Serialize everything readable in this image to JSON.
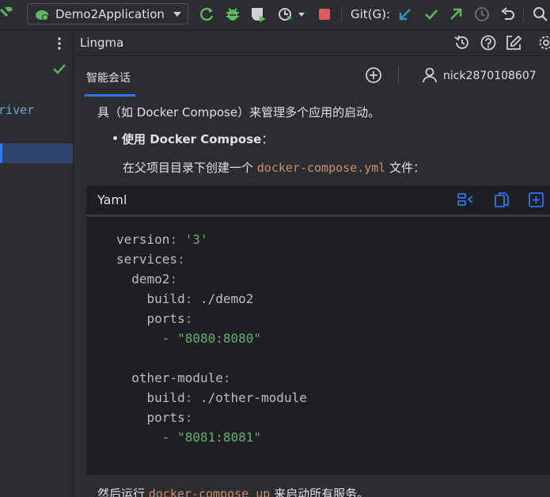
{
  "toolbar": {
    "run_config": "Demo2Application",
    "git_label": "Git(G):"
  },
  "left_panel": {
    "visible_text": "Driver"
  },
  "panel": {
    "title": "Lingma"
  },
  "tabs": {
    "chat_label": "智能会话",
    "user_name": "nick2870108607"
  },
  "content": {
    "para1": "具（如 Docker Compose）来管理多个应用的启动。",
    "bullet_title": "使用 Docker Compose",
    "bullet_colon": "：",
    "para2_prefix": "在父项目目录下创建一个 ",
    "para2_code": "docker-compose.yml",
    "para2_suffix": " 文件：",
    "code_lang": "Yaml",
    "code_lines": [
      "version: '3'",
      "services:",
      "  demo2:",
      "    build: ./demo2",
      "    ports:",
      "      - \"8080:8080\"",
      "",
      "  other-module:",
      "    build: ./other-module",
      "    ports:",
      "      - \"8081:8081\""
    ],
    "para3_prefix": "然后运行 ",
    "para3_code": "docker-compose up",
    "para3_suffix": " 来启动所有服务。"
  },
  "colors": {
    "accent": "#3574f0",
    "success": "#5fb865",
    "stop": "#db5c5c",
    "code_keyword": "#cf8e6d",
    "code_string": "#6aab73"
  }
}
